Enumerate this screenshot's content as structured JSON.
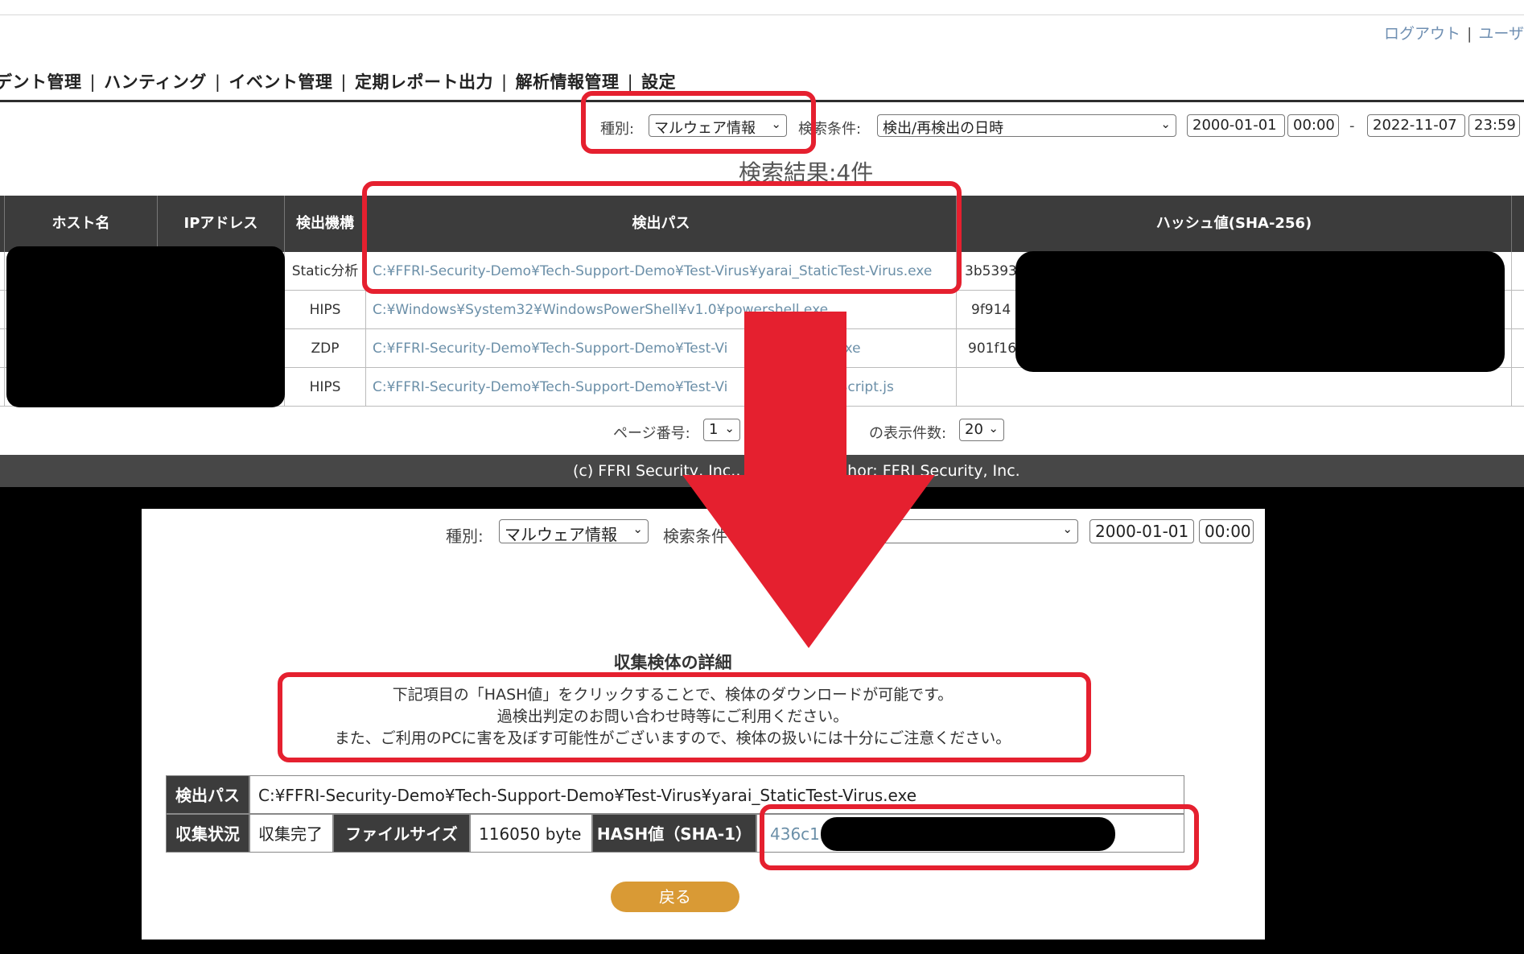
{
  "top": {
    "header": {
      "logout": "ログアウト",
      "user_partial": "ユーザ",
      "separator": "|"
    },
    "nav": {
      "items": [
        "デント管理",
        "ハンティング",
        "イベント管理",
        "定期レポート出力",
        "解析情報管理",
        "設定"
      ],
      "separator": "|"
    },
    "filters": {
      "type_label": "種別:",
      "type_value": "マルウェア情報",
      "condition_label": "検索条件:",
      "condition_value": "検出/再検出の日時",
      "from_date": "2000-01-01",
      "from_time": "00:00",
      "range_sep": "-",
      "to_date": "2022-11-07",
      "to_time": "23:59"
    },
    "result_count": "検索結果:4件",
    "table": {
      "headers": [
        "ホスト名",
        "IPアドレス",
        "検出機構",
        "検出パス",
        "ハッシュ値(SHA-256)"
      ],
      "rows": [
        {
          "engine": "Static分析",
          "path": "C:¥FFRI-Security-Demo¥Tech-Support-Demo¥Test-Virus¥yarai_StaticTest-Virus.exe",
          "hash": "3b5393"
        },
        {
          "engine": "HIPS",
          "path": "C:¥Windows¥System32¥WindowsPowerShell¥v1.0¥powershell.exe",
          "hash": "9f914"
        },
        {
          "engine": "ZDP",
          "path": "C:¥FFRI-Security-Demo¥Tech-Support-Demo¥Test-Vi                        .exe",
          "hash": "901f16"
        },
        {
          "engine": "HIPS",
          "path": "C:¥FFRI-Security-Demo¥Tech-Support-Demo¥Test-Vi                        _Script.js",
          "hash": ""
        }
      ]
    },
    "pager": {
      "page_label": "ページ番号:",
      "page_value": "1",
      "per_page_label": "の表示件数:",
      "per_page_value": "20"
    },
    "footer": "(c) FFRI Security, Inc.,                      hor: FFRI Security, Inc."
  },
  "bottom": {
    "filters": {
      "type_label": "種別:",
      "type_value": "マルウェア情報",
      "condition_label": "検索条件",
      "from_date": "2000-01-01",
      "from_time": "00:00"
    },
    "title": "収集検体の詳細",
    "notice": [
      "下記項目の「HASH値」をクリックすることで、検体のダウンロードが可能です。",
      "過検出判定のお問い合わせ時等にご利用ください。",
      "また、ご利用のPCに害を及ぼす可能性がございますので、検体の扱いには十分にご注意ください。"
    ],
    "details": {
      "path_label": "検出パス",
      "path_value": "C:¥FFRI-Security-Demo¥Tech-Support-Demo¥Test-Virus¥yarai_StaticTest-Virus.exe",
      "status_label": "収集状況",
      "status_value": "収集完了",
      "size_label": "ファイルサイズ",
      "size_value": "116050 byte",
      "hash_label": "HASH値（SHA-1）",
      "hash_value": "436c1"
    },
    "back_button": "戻る"
  },
  "colors": {
    "highlight": "#e5202f",
    "arrow": "#e5202f",
    "header_dark": "#3c3c3c",
    "link": "#6b8fa8",
    "back_button": "#d99a35"
  }
}
